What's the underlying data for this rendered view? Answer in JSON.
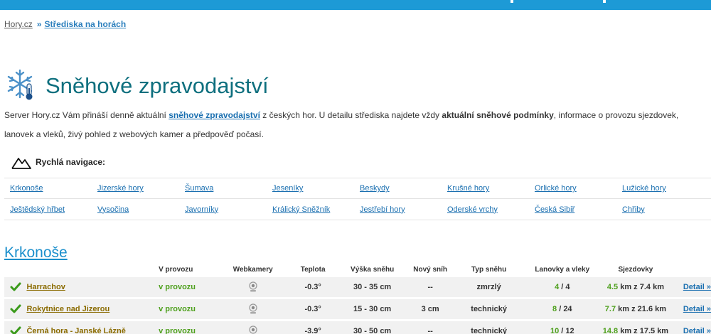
{
  "breadcrumb": {
    "home": "Hory.cz",
    "separator": "»",
    "current": "Střediska na horách"
  },
  "page_title": "Sněhové zpravodajství",
  "intro": {
    "part1": "Server Hory.cz Vám přináší denně aktuální ",
    "link": "sněhové zpravodajství",
    "part2": " z českých hor. U detailu střediska najdete vždy ",
    "bold": "aktuální sněhové podmínky",
    "part3": ", informace o provozu sjezdovek, lanovek a vleků, živý pohled z webových kamer a předpověď počasí."
  },
  "quick_nav": {
    "heading": "Rychlá navigace:",
    "rows": [
      [
        "Krkonoše",
        "Jizerské hory",
        "Šumava",
        "Jeseníky",
        "Beskydy",
        "Krušné hory",
        "Orlické hory",
        "Lužické hory"
      ],
      [
        "Ještědský hřbet",
        "Vysočina",
        "Javorníky",
        "Králický Sněžník",
        "Jestřebí hory",
        "Oderské vrchy",
        "Česká Sibiř",
        "Chřiby"
      ]
    ]
  },
  "region": {
    "title": "Krkonoše",
    "columns": {
      "state": "V provozu",
      "cams": "Webkamery",
      "temp": "Teplota",
      "snow": "Výška sněhu",
      "new": "Nový sníh",
      "type": "Typ sněhu",
      "lifts": "Lanovky a vleky",
      "slopes": "Sjezdovky"
    },
    "rows": [
      {
        "name": "Harrachov",
        "state": "v provozu",
        "temp": "-0.3°",
        "snow": "30 - 35 cm",
        "new": "--",
        "type": "zmrzlý",
        "lifts_open": "4",
        "lifts_sep": " / ",
        "lifts_total": "4",
        "slopes_open": "4.5",
        "slopes_rest": " km z 7.4 km",
        "detail": "Detail »"
      },
      {
        "name": "Rokytnice nad Jizerou",
        "state": "v provozu",
        "temp": "-0.3°",
        "snow": "15 - 30 cm",
        "new": "3 cm",
        "type": "technický",
        "lifts_open": "8",
        "lifts_sep": " / ",
        "lifts_total": "24",
        "slopes_open": "7.7",
        "slopes_rest": " km z 21.6 km",
        "detail": "Detail »"
      },
      {
        "name": "Černá hora - Janské Lázně",
        "state": "v provozu",
        "temp": "-3.9°",
        "snow": "30 - 50 cm",
        "new": "--",
        "type": "technický",
        "lifts_open": "10",
        "lifts_sep": " / ",
        "lifts_total": "12",
        "slopes_open": "14.8",
        "slopes_rest": " km z 17.5 km",
        "detail": "Detail »"
      }
    ]
  },
  "colors": {
    "topbar": "#1d9ad6",
    "title": "#0d6f7e",
    "link": "#1a6fb0",
    "green": "#4ea01d",
    "resort_link": "#8a6b00"
  }
}
